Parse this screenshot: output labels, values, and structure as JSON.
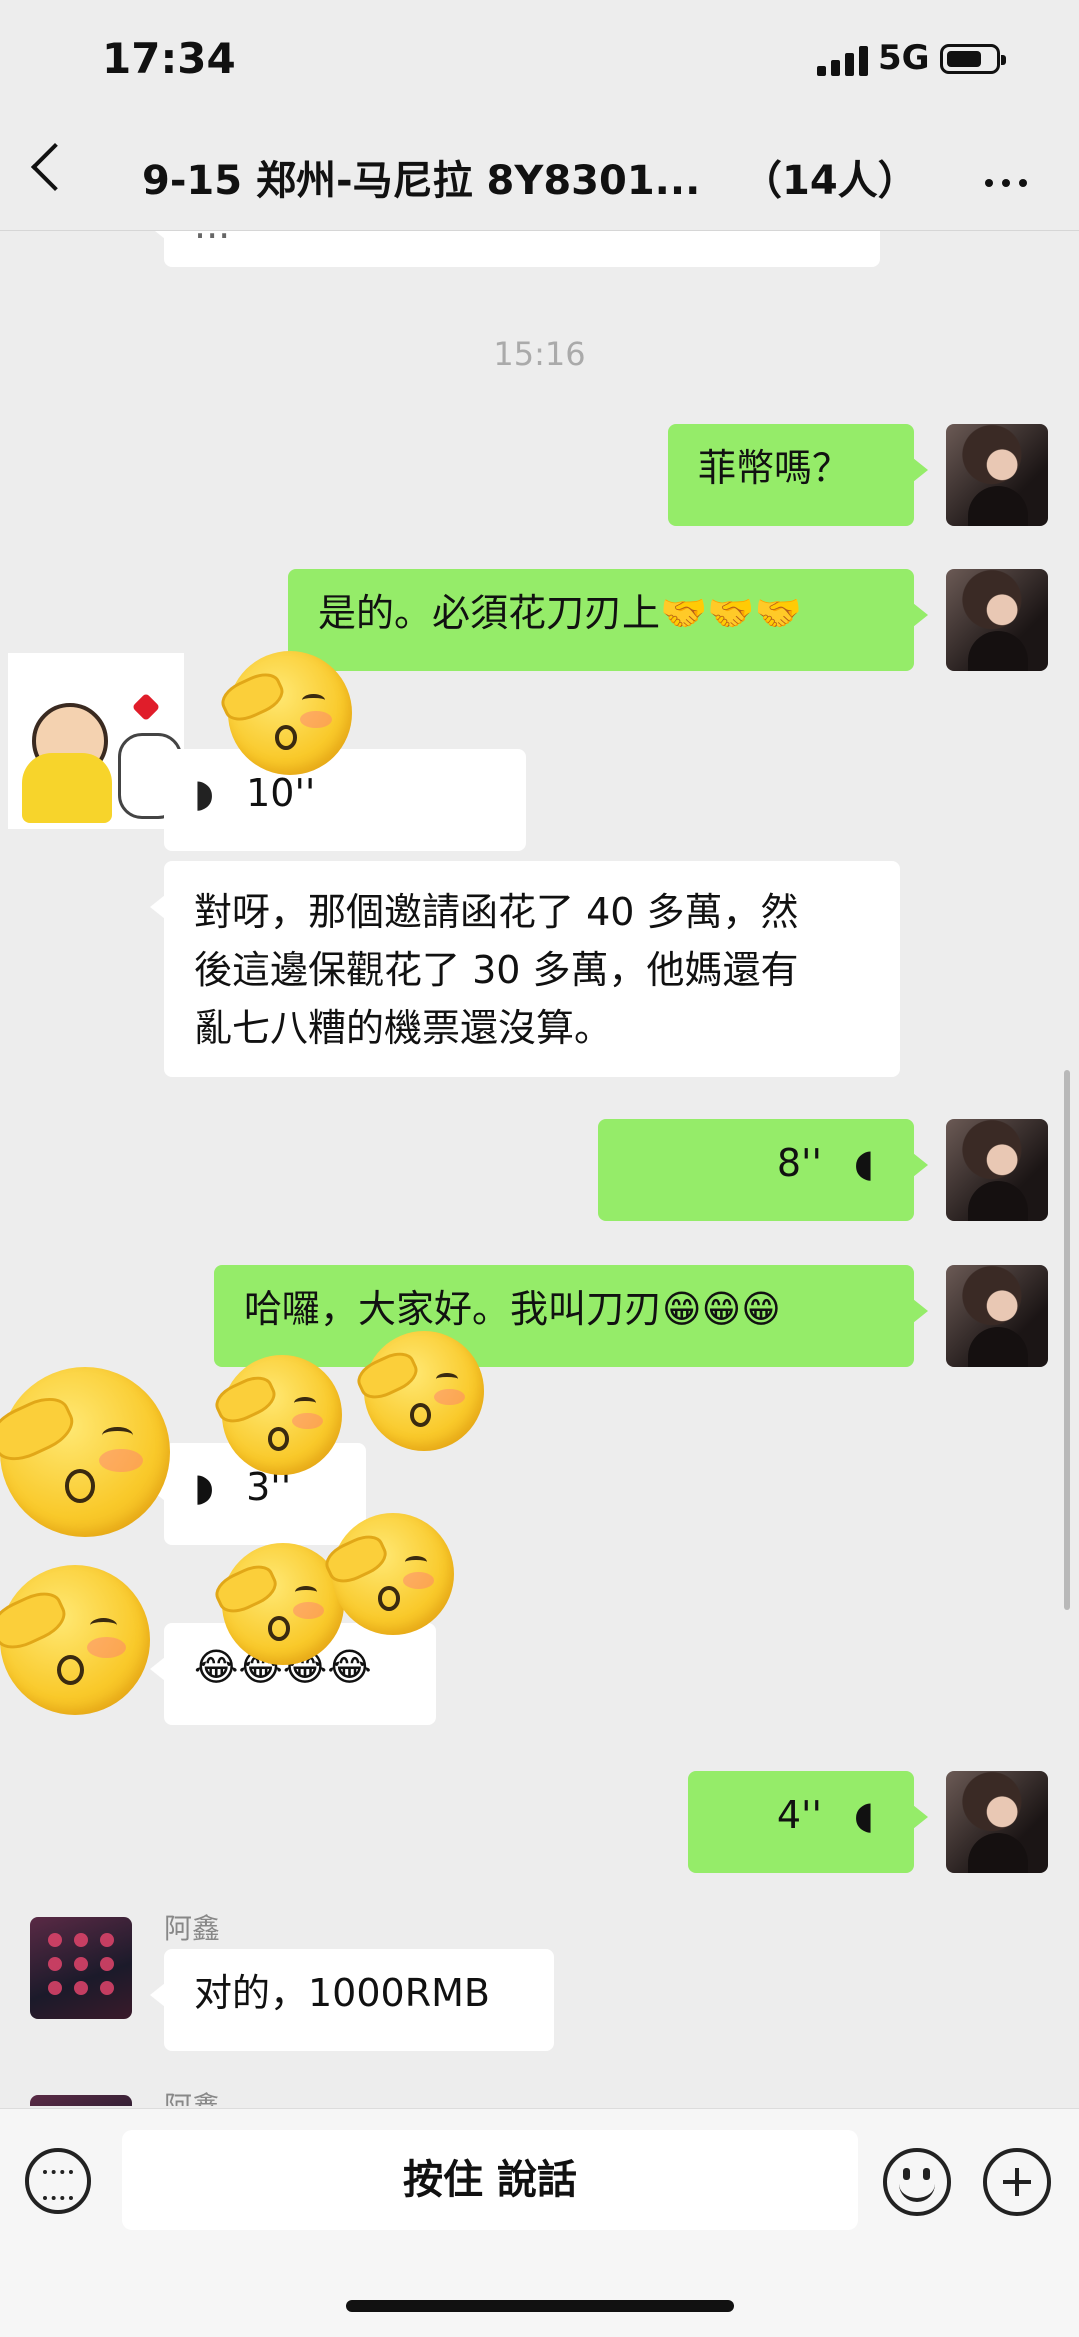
{
  "status_bar": {
    "time": "17:34",
    "network": "5G"
  },
  "header": {
    "title": "9-15 郑州-马尼拉 8Y8301...",
    "member_count": "（14人）"
  },
  "messages": {
    "partial_top": "...",
    "time_1": "15:16",
    "m1": "菲幣嗎？",
    "m2": "是的。必須花刀刃上🤝🤝🤝",
    "voice1": "10''",
    "m3_line1": "對呀，那個邀請函花了 40 多萬，然",
    "m3_line2": "後這邊保觀花了 30 多萬，他媽還有",
    "m3_line3": "亂七八糟的機票還沒算。",
    "voice2": "8''",
    "m4": "哈囉，大家好。我叫刀刃😁😁😁",
    "voice3": "3''",
    "m5": "😂😂😂😂",
    "voice4": "4''",
    "sender1": "阿鑫",
    "m6": "对的，1000RMB",
    "sender2": "阿鑫"
  },
  "input": {
    "talk_label": "按住 說話"
  },
  "colors": {
    "outgoing": "#95ec69",
    "incoming": "#ffffff",
    "background": "#ededed"
  },
  "icons": [
    "back-icon",
    "more-icon",
    "voice-icon",
    "keyboard-icon",
    "emoji-icon",
    "plus-icon"
  ]
}
